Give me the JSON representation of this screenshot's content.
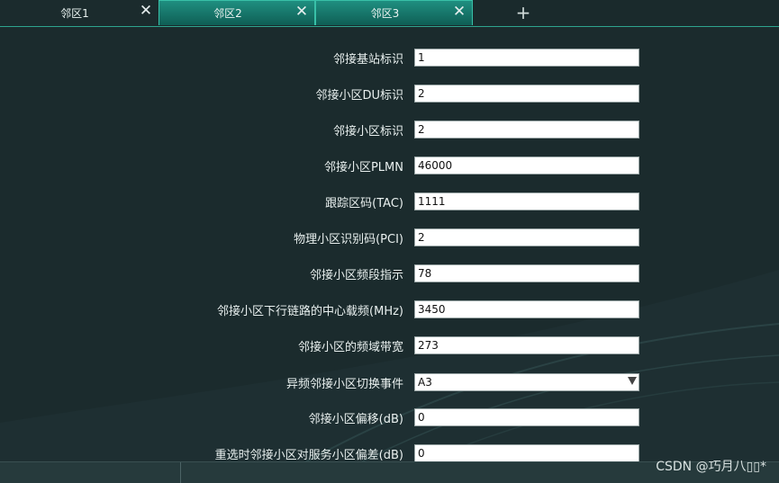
{
  "tabs": [
    {
      "label": "邻区1",
      "active": true
    },
    {
      "label": "邻区2",
      "active": false
    },
    {
      "label": "邻区3",
      "active": false
    }
  ],
  "form": {
    "fields": [
      {
        "label": "邻接基站标识",
        "value": "1"
      },
      {
        "label": "邻接小区DU标识",
        "value": "2"
      },
      {
        "label": "邻接小区标识",
        "value": "2"
      },
      {
        "label": "邻接小区PLMN",
        "value": "46000"
      },
      {
        "label": "跟踪区码(TAC)",
        "value": "1111"
      },
      {
        "label": "物理小区识别码(PCI)",
        "value": "2"
      },
      {
        "label": "邻接小区频段指示",
        "value": "78"
      },
      {
        "label": "邻接小区下行链路的中心载频(MHz)",
        "value": "3450"
      },
      {
        "label": "邻接小区的频域带宽",
        "value": "273"
      },
      {
        "label": "异频邻接小区切换事件",
        "value": "A3"
      },
      {
        "label": "邻接小区偏移(dB)",
        "value": "0"
      },
      {
        "label": "重选时邻接小区对服务小区偏差(dB)",
        "value": "0"
      }
    ]
  },
  "watermark": "CSDN @巧月八▯▯*",
  "colors": {
    "background": "#1b2b2d",
    "tab_accent": "#2ea58f"
  }
}
